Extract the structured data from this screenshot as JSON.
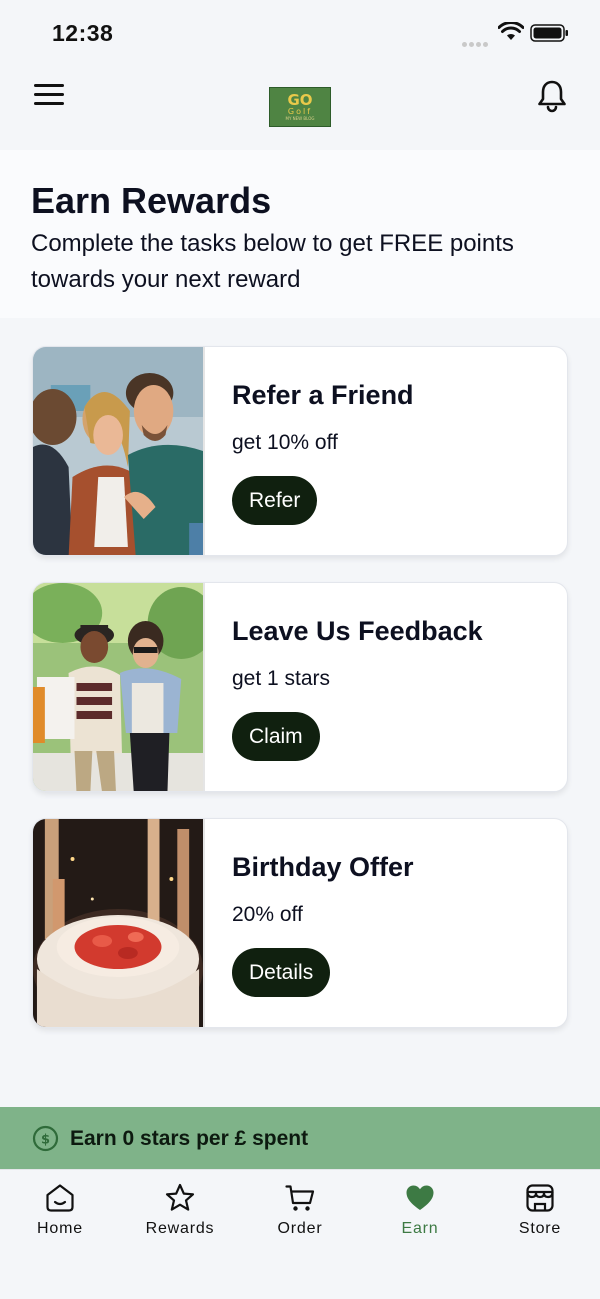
{
  "status_bar": {
    "time": "12:38"
  },
  "header": {
    "logo": {
      "title": "GO",
      "sub": "Golf",
      "tag": "MY NEW BLOG"
    }
  },
  "intro": {
    "title": "Earn Rewards",
    "subtitle": "Complete the tasks below to get FREE points towards your next reward"
  },
  "cards": [
    {
      "title": "Refer a Friend",
      "description": "get 10% off",
      "button": "Refer",
      "image": "friends-laughing-photo"
    },
    {
      "title": "Leave Us Feedback",
      "description": "get 1 stars",
      "button": "Claim",
      "image": "couple-shopping-photo"
    },
    {
      "title": "Birthday Offer",
      "description": "20% off",
      "button": "Details",
      "image": "birthday-cake-photo"
    }
  ],
  "earn_banner": {
    "text": "Earn 0 stars per £ spent",
    "icon": "dollar-circle-icon"
  },
  "tabs": [
    {
      "label": "Home",
      "icon": "home-icon"
    },
    {
      "label": "Rewards",
      "icon": "star-icon"
    },
    {
      "label": "Order",
      "icon": "cart-icon"
    },
    {
      "label": "Earn",
      "icon": "heart-icon",
      "active": true
    },
    {
      "label": "Store",
      "icon": "store-icon"
    }
  ],
  "colors": {
    "accent": "#3d7a44",
    "banner": "#7fb389",
    "button": "#10200f",
    "background": "#f4f6f9"
  }
}
